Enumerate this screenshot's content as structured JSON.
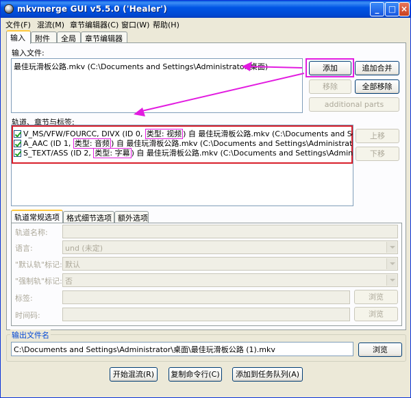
{
  "window": {
    "title": "mkvmerge GUI v5.5.0 ('Healer')"
  },
  "menu": [
    "文件(F)",
    "混流(M)",
    "章节编辑器(C)",
    "窗口(W)",
    "帮助(H)"
  ],
  "tabs": [
    "输入",
    "附件",
    "全局",
    "章节编辑器"
  ],
  "input": {
    "files_label": "输入文件:",
    "file": "最佳玩滑板公路.mkv (C:\\Documents and Settings\\Administrator\\桌面)",
    "add": "添加",
    "append": "追加合并",
    "remove": "移除",
    "remove_all": "全部移除",
    "additional_parts": "additional parts"
  },
  "tracks": {
    "label": "轨道、章节与标签:",
    "up": "上移",
    "down": "下移",
    "items": [
      {
        "pre": "V_MS/VFW/FOURCC, DIVX (ID 0, ",
        "type": "类型: 视频",
        "post": ") 自 最佳玩滑板公路.mkv (C:\\Documents and Settings\\Administrator\\桌面)"
      },
      {
        "pre": "A_AAC (ID 1, ",
        "type": "类型: 音频",
        "post": ") 自 最佳玩滑板公路.mkv (C:\\Documents and Settings\\Administrator\\桌面)"
      },
      {
        "pre": "S_TEXT/ASS (ID 2, ",
        "type": "类型: 字幕",
        "post": ") 自 最佳玩滑板公路.mkv (C:\\Documents and Settings\\Administrator\\桌面)"
      }
    ]
  },
  "subtabs": [
    "轨道常规选项",
    "格式细节选项",
    "额外选项"
  ],
  "options": {
    "track_name": "轨道名称:",
    "language": "语言:",
    "language_value": "und (未定)",
    "default_flag": "\"默认轨\"标记:",
    "default_value": "默认",
    "forced_flag": "\"强制轨\"标记:",
    "forced_value": "否",
    "tags": "标签:",
    "timecodes": "时间码:",
    "browse": "浏览"
  },
  "output": {
    "group_title": "输出文件名",
    "path": "C:\\Documents and Settings\\Administrator\\桌面\\最佳玩滑板公路 (1).mkv",
    "browse": "浏览"
  },
  "actions": {
    "start": "开始混流(R)",
    "copy_cmd": "复制命令行(C)",
    "add_job": "添加到任务队列(A)"
  },
  "colors": {
    "highlight": "#E21BE0",
    "track_box": "#D81E2A"
  }
}
